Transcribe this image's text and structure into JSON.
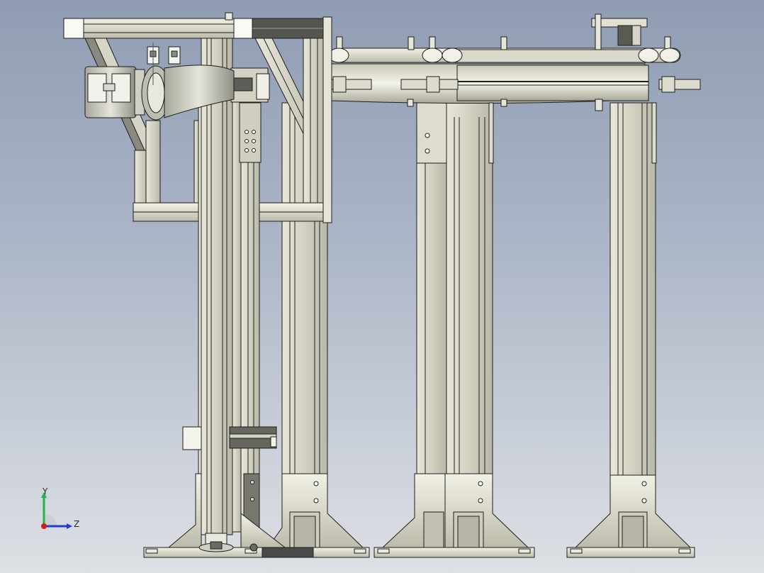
{
  "viewport": {
    "background_top": "#8f9cb3",
    "background_bottom": "#dde0e4",
    "model_fill": "#d7d6c6",
    "model_edge": "#1e1e1e",
    "dark_part": "#4a4a4a"
  },
  "triad": {
    "y_label": "Y",
    "z_label": "Z",
    "y_color": "#22b14c",
    "z_color": "#1f3fcf",
    "x_color": "#d01f1f"
  }
}
